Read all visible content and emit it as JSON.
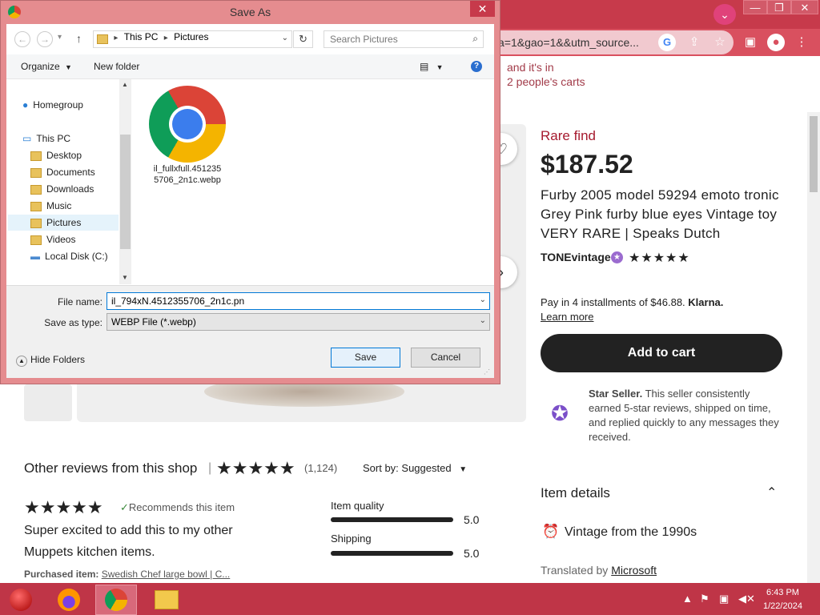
{
  "browser": {
    "url": "a=1&gao=1&&utm_source...",
    "minimize": "—",
    "restore": "❐",
    "close": "✕"
  },
  "page": {
    "cart_note_1": "and it's in",
    "cart_note_2": "2 people's carts",
    "rare_find": "Rare find",
    "price": "$187.52",
    "title": "Furby 2005 model 59294 emoto tronic Grey Pink furby blue eyes Vintage toy VERY RARE | Speaks Dutch",
    "shop_name": "TONEvintage",
    "installments_prefix": "Pay in 4 installments of $46.88.",
    "installments_brand": "Klarna.",
    "learn_more": "Learn more",
    "add_to_cart": "Add to cart",
    "star_seller_bold": "Star Seller.",
    "star_seller_text": "This seller consistently earned 5-star reviews, shipped on time, and replied quickly to any messages they received.",
    "reviews_heading": "Other reviews from this shop",
    "review_count": "(1,124)",
    "sort_label": "Sort by: Suggested",
    "recommends": "Recommends this item",
    "review_text": "Super excited to add this to my other Muppets kitchen items.",
    "purchased_label": "Purchased item:",
    "purchased_item": "Swedish Chef large bowl | C...",
    "ratings": [
      {
        "label": "Item quality",
        "value": "5.0",
        "fraction": 1.0
      },
      {
        "label": "Shipping",
        "value": "5.0",
        "fraction": 1.0
      }
    ],
    "item_details": "Item details",
    "vintage": "Vintage from the 1990s",
    "translated_prefix": "Translated by",
    "translated_by": "Microsoft"
  },
  "dialog": {
    "title": "Save As",
    "close": "✕",
    "path_this_pc": "This PC",
    "path_pictures": "Pictures",
    "search_placeholder": "Search Pictures",
    "organize": "Organize",
    "new_folder": "New folder",
    "nav": {
      "homegroup": "Homegroup",
      "this_pc": "This PC",
      "desktop": "Desktop",
      "documents": "Documents",
      "downloads": "Downloads",
      "music": "Music",
      "pictures": "Pictures",
      "videos": "Videos",
      "local_disk": "Local Disk (C:)"
    },
    "file_caption_1": "il_fullxfull.451235",
    "file_caption_2": "5706_2n1c.webp",
    "file_name_label": "File name:",
    "file_name_value": "il_794xN.4512355706_2n1c.pn",
    "save_type_label": "Save as type:",
    "save_type_value": "WEBP File (*.webp)",
    "hide_folders": "Hide Folders",
    "save": "Save",
    "cancel": "Cancel"
  },
  "taskbar": {
    "time": "6:43 PM",
    "date": "1/22/2024"
  },
  "colors": {
    "browser_frame": "#c73a4b",
    "dialog_frame": "#e58c8f",
    "taskbar": "#bf3547",
    "rare_find": "#a61a2e"
  }
}
